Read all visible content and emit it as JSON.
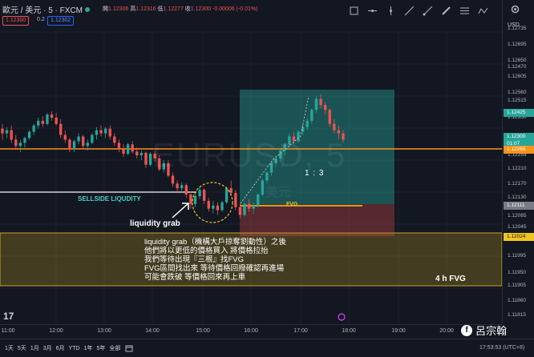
{
  "header": {
    "symbol": "歐元 / 美元 · 5 · FXCM",
    "ohlc": [
      {
        "k": "開",
        "v": "1.12306"
      },
      {
        "k": "高",
        "v": "1.12316"
      },
      {
        "k": "低",
        "v": "1.12277"
      },
      {
        "k": "收",
        "v": "1.12300"
      },
      {
        "k": "",
        "v": "-0.00006 (-0.01%)"
      }
    ],
    "sell_price": "1.12300",
    "spread": "0.2",
    "buy_price": "1.12302"
  },
  "toolbar": {
    "icons": [
      "rectangle-tool-icon",
      "hline-tool-icon",
      "vline-tool-icon",
      "trendline-tool-icon",
      "ray-tool-icon",
      "pencil-tool-icon",
      "fib-tool-icon",
      "path-tool-icon"
    ]
  },
  "price_axis": {
    "currency": "USD",
    "ticks": [
      "1.12735",
      "1.12695",
      "1.12650",
      "1.12605",
      "1.12560",
      "1.12515",
      "1.12470",
      "1.12350",
      "1.12255",
      "1.12210",
      "1.12170",
      "1.12130",
      "1.12085",
      "1.12045",
      "1.11995",
      "1.11950",
      "1.11905",
      "1.11860",
      "1.11815",
      "1.11775"
    ],
    "labels": {
      "target": "1.12425",
      "current": "1.12300",
      "countdown": "01:07",
      "orange": "1.12265",
      "fvg_top": "1.12111",
      "yellow_top": "1.12024"
    }
  },
  "time_axis": {
    "ticks": [
      "11:00",
      "12:00",
      "13:00",
      "14:00",
      "15:00",
      "16:00",
      "17:00",
      "18:00",
      "19:00",
      "20:00"
    ]
  },
  "ranges": [
    "1天",
    "5天",
    "1月",
    "3月",
    "6月",
    "YTD",
    "1年",
    "5年",
    "全部"
  ],
  "clock": "17:53:53 (UTC+8)",
  "annotations": {
    "sellside": "SELLSIDE LIQUDITY",
    "liquidity_grab": "liquidity grab",
    "fvg": "FVG",
    "risk_reward": "1  :  3",
    "fvg_4h": "4 h FVG",
    "note_lines": [
      "liquidity grab（機構大戶掠奪劉動性）之後",
      "他們將以更低的價格買入 將價格拉抬",
      "我們等待出現『三根』找FVG",
      "FVG區間找出來 等待價格回撥確認再進場",
      "可能會跌破 等價格回來再上車"
    ],
    "watermark": "EURUSD, 5",
    "watermark_sub": "美元"
  },
  "author": "呂宗翰",
  "tv_logo": "17",
  "colors": {
    "up": "#26a69a",
    "down": "#ef5350",
    "orange_line": "#f7931a",
    "sellside_line": "#d1d4dc",
    "target_zone": "rgba(38,166,154,0.45)",
    "stop_zone": "rgba(239,83,80,0.32)",
    "yellow_zone": "rgba(240,197,31,0.25)",
    "fvg_line": "#f0c51f"
  },
  "chart_data": {
    "type": "candlestick",
    "price_range": [
      1.1175,
      1.1275
    ],
    "candles_ohlc": [
      [
        1.12335,
        1.1235,
        1.123,
        1.1232
      ],
      [
        1.1232,
        1.1234,
        1.12305,
        1.1233
      ],
      [
        1.1233,
        1.12345,
        1.1229,
        1.123
      ],
      [
        1.123,
        1.12315,
        1.1227,
        1.1228
      ],
      [
        1.1228,
        1.123,
        1.1226,
        1.1229
      ],
      [
        1.1229,
        1.1231,
        1.12275,
        1.12305
      ],
      [
        1.12305,
        1.1233,
        1.123,
        1.12325
      ],
      [
        1.12325,
        1.1235,
        1.12315,
        1.12345
      ],
      [
        1.12345,
        1.1237,
        1.12335,
        1.1236
      ],
      [
        1.1236,
        1.12375,
        1.1234,
        1.1235
      ],
      [
        1.1235,
        1.12385,
        1.12345,
        1.1238
      ],
      [
        1.1238,
        1.1239,
        1.1236,
        1.1237
      ],
      [
        1.1237,
        1.12385,
        1.12345,
        1.1235
      ],
      [
        1.1235,
        1.12365,
        1.12305,
        1.12315
      ],
      [
        1.12315,
        1.1233,
        1.1229,
        1.123
      ],
      [
        1.123,
        1.12305,
        1.1226,
        1.1227
      ],
      [
        1.1227,
        1.123,
        1.1226,
        1.12295
      ],
      [
        1.12295,
        1.1232,
        1.12285,
        1.1231
      ],
      [
        1.1231,
        1.12315,
        1.1227,
        1.1228
      ],
      [
        1.1228,
        1.123,
        1.12265,
        1.1229
      ],
      [
        1.1229,
        1.1232,
        1.12285,
        1.12315
      ],
      [
        1.12315,
        1.1234,
        1.123,
        1.1233
      ],
      [
        1.1233,
        1.12345,
        1.1231,
        1.1232
      ],
      [
        1.1232,
        1.1234,
        1.12305,
        1.12335
      ],
      [
        1.12335,
        1.12345,
        1.123,
        1.1231
      ],
      [
        1.1231,
        1.1232,
        1.1228,
        1.1229
      ],
      [
        1.1229,
        1.123,
        1.1226,
        1.1227
      ],
      [
        1.1227,
        1.12285,
        1.12245,
        1.12255
      ],
      [
        1.12255,
        1.1229,
        1.1225,
        1.12285
      ],
      [
        1.12285,
        1.12295,
        1.12255,
        1.12262
      ],
      [
        1.12262,
        1.12275,
        1.1224,
        1.1225
      ],
      [
        1.1225,
        1.12265,
        1.12235,
        1.12258
      ],
      [
        1.12258,
        1.12262,
        1.1221,
        1.1222
      ],
      [
        1.1222,
        1.1226,
        1.12215,
        1.12255
      ],
      [
        1.12255,
        1.12265,
        1.1223,
        1.1224
      ],
      [
        1.1224,
        1.1225,
        1.122,
        1.12205
      ],
      [
        1.12205,
        1.12235,
        1.12195,
        1.12225
      ],
      [
        1.12225,
        1.12235,
        1.1218,
        1.12185
      ],
      [
        1.12185,
        1.12195,
        1.1215,
        1.1216
      ],
      [
        1.1216,
        1.1217,
        1.1213,
        1.12145
      ],
      [
        1.12145,
        1.12165,
        1.1213,
        1.12155
      ],
      [
        1.12155,
        1.1216,
        1.12115,
        1.12125
      ],
      [
        1.12125,
        1.12135,
        1.1208,
        1.12095
      ],
      [
        1.12095,
        1.1213,
        1.12085,
        1.1212
      ],
      [
        1.1212,
        1.1215,
        1.1211,
        1.1214
      ],
      [
        1.1214,
        1.12145,
        1.12095,
        1.12105
      ],
      [
        1.12105,
        1.12115,
        1.1207,
        1.1208
      ],
      [
        1.1208,
        1.12105,
        1.12065,
        1.1209
      ],
      [
        1.1209,
        1.121,
        1.1206,
        1.12075
      ],
      [
        1.12075,
        1.12105,
        1.1207,
        1.121
      ],
      [
        1.121,
        1.1215,
        1.12095,
        1.12145
      ],
      [
        1.12145,
        1.1217,
        1.1212,
        1.1213
      ],
      [
        1.1213,
        1.1214,
        1.12075,
        1.12085
      ],
      [
        1.12085,
        1.12095,
        1.1205,
        1.1206
      ],
      [
        1.1206,
        1.121,
        1.12055,
        1.12095
      ],
      [
        1.12095,
        1.1211,
        1.1207,
        1.1208
      ],
      [
        1.1208,
        1.121,
        1.12065,
        1.1209
      ],
      [
        1.1209,
        1.1213,
        1.12085,
        1.12125
      ],
      [
        1.12125,
        1.12175,
        1.1212,
        1.1217
      ],
      [
        1.1217,
        1.122,
        1.1216,
        1.12195
      ],
      [
        1.12195,
        1.1223,
        1.12185,
        1.12225
      ],
      [
        1.12225,
        1.1225,
        1.12215,
        1.1224
      ],
      [
        1.1224,
        1.1227,
        1.1223,
        1.12265
      ],
      [
        1.12265,
        1.1229,
        1.1225,
        1.12285
      ],
      [
        1.12285,
        1.1232,
        1.12275,
        1.1231
      ],
      [
        1.1231,
        1.12325,
        1.12285,
        1.12295
      ],
      [
        1.12295,
        1.1233,
        1.1229,
        1.12325
      ],
      [
        1.12325,
        1.1235,
        1.12315,
        1.1234
      ],
      [
        1.1234,
        1.1237,
        1.1233,
        1.1236
      ],
      [
        1.1236,
        1.124,
        1.1235,
        1.12395
      ],
      [
        1.12395,
        1.1244,
        1.12385,
        1.1243
      ],
      [
        1.1243,
        1.12445,
        1.124,
        1.1241
      ],
      [
        1.1241,
        1.1242,
        1.1238,
        1.12395
      ],
      [
        1.12395,
        1.124,
        1.1234,
        1.1235
      ],
      [
        1.1235,
        1.12365,
        1.1232,
        1.1233
      ],
      [
        1.1233,
        1.12345,
        1.123,
        1.1232
      ],
      [
        1.1232,
        1.1233,
        1.1229,
        1.123
      ]
    ]
  }
}
